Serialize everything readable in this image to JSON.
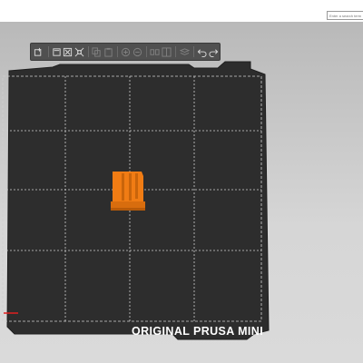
{
  "search": {
    "placeholder": "Enter a search term"
  },
  "toolbar": {
    "items": [
      {
        "icon": "add-object-icon",
        "enabled": true
      },
      {
        "icon": "delete-icon",
        "enabled": true
      },
      {
        "icon": "delete-all-icon",
        "enabled": true
      },
      {
        "icon": "arrange-icon",
        "enabled": true
      },
      {
        "icon": "copy-icon",
        "enabled": false
      },
      {
        "icon": "paste-icon",
        "enabled": false
      },
      {
        "icon": "add-instance-icon",
        "enabled": false
      },
      {
        "icon": "remove-instance-icon",
        "enabled": false
      },
      {
        "icon": "split-objects-icon",
        "enabled": false
      },
      {
        "icon": "split-parts-icon",
        "enabled": false
      },
      {
        "icon": "layers-editing-icon",
        "enabled": false
      },
      {
        "icon": "undo-icon",
        "enabled": true
      },
      {
        "icon": "redo-icon",
        "enabled": true
      }
    ]
  },
  "bed": {
    "label": "ORIGINAL PRUSA MINI"
  },
  "colors": {
    "bed": "#2d2d2d",
    "bed_plate": "#333333",
    "grid_lines": "#cfcfcf",
    "object": "#f07c14",
    "object_shadow": "#b85a08",
    "toolbar": "#505050",
    "axis_x": "#e02020"
  }
}
